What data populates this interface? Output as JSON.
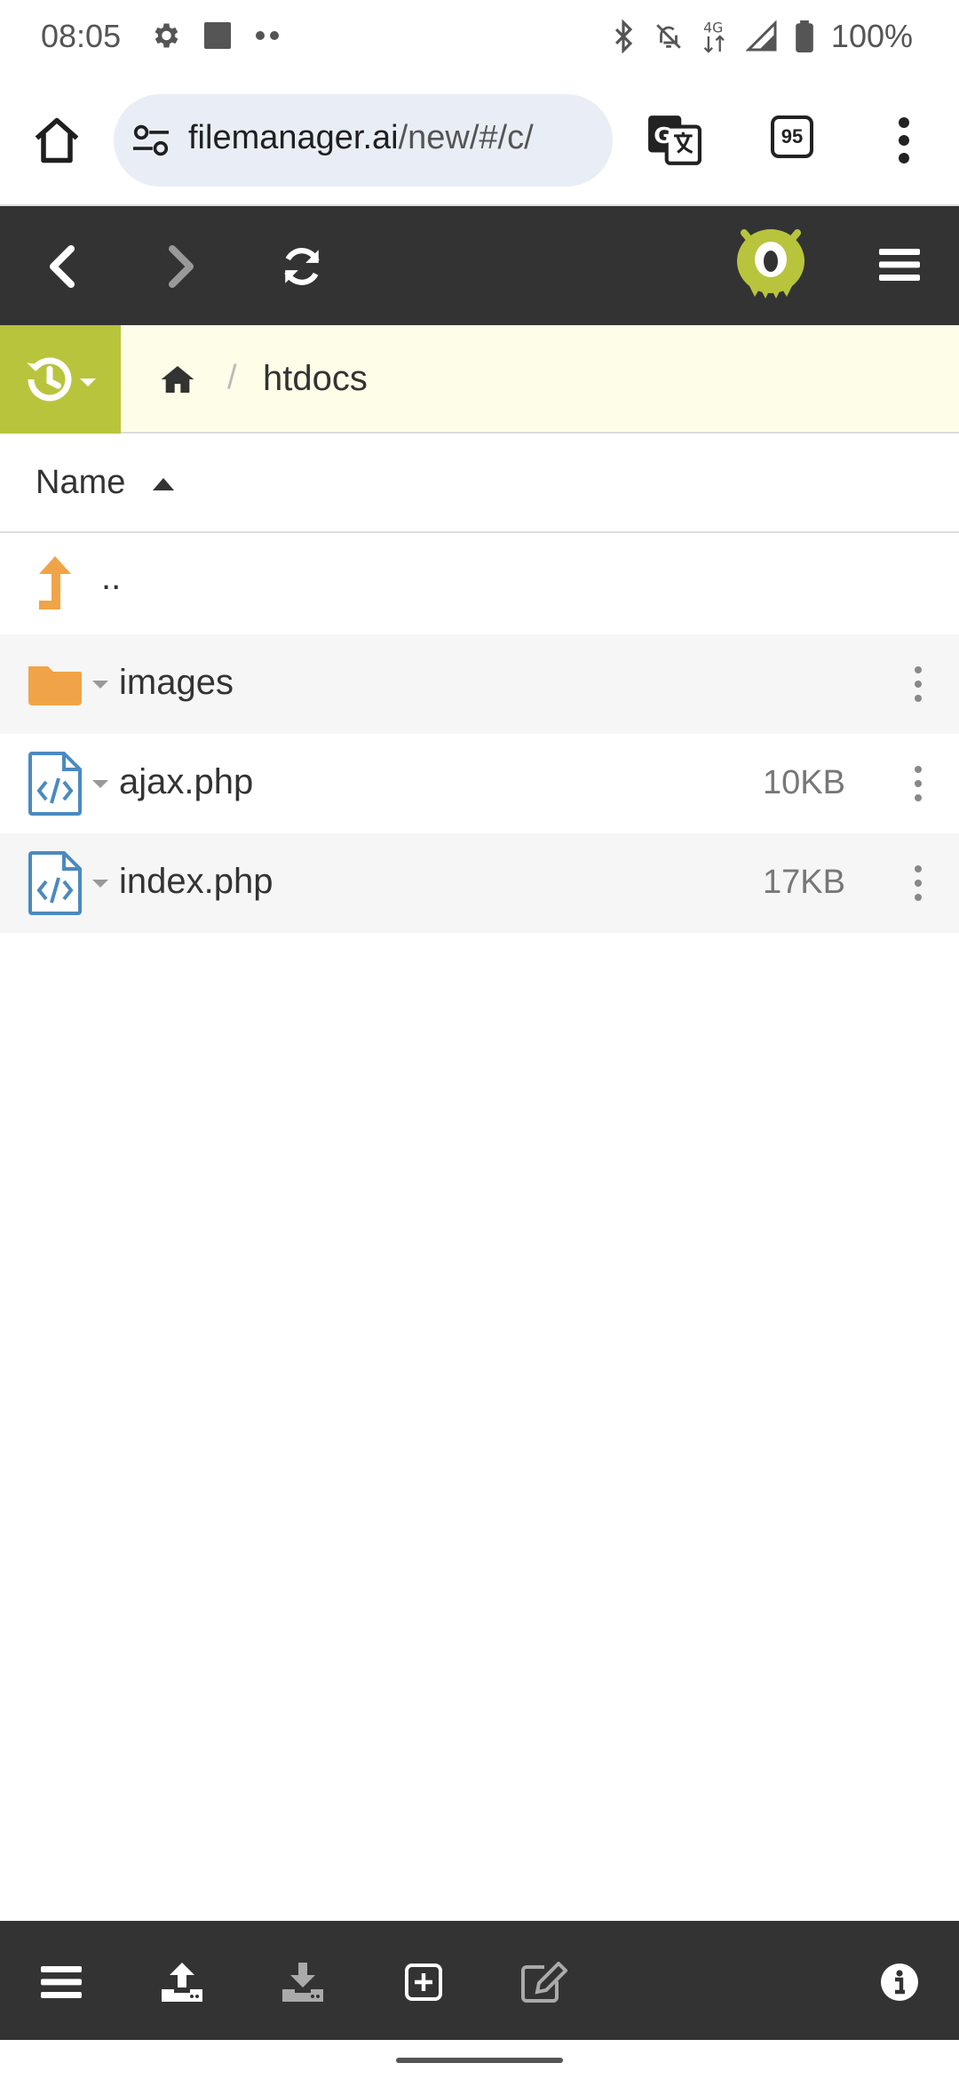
{
  "status_bar": {
    "time": "08:05",
    "battery": "100%",
    "network": "4G"
  },
  "browser": {
    "url_host": "filemanager.ai",
    "url_rest": "/new/#/c/",
    "tab_count": "95"
  },
  "breadcrumb": {
    "separator": "/",
    "current": "htdocs"
  },
  "list_header": {
    "name_label": "Name"
  },
  "files": [
    {
      "name": "..",
      "size": "",
      "type": "parent"
    },
    {
      "name": "images",
      "size": "",
      "type": "folder"
    },
    {
      "name": "ajax.php",
      "size": "10KB",
      "type": "code-file"
    },
    {
      "name": "index.php",
      "size": "17KB",
      "type": "code-file"
    }
  ],
  "colors": {
    "toolbar_bg": "#333333",
    "accent_green": "#b9c43d",
    "breadcrumb_bg": "#fefde8",
    "folder_orange": "#f0a447",
    "file_blue": "#4a8ac0"
  },
  "icons": {
    "toolbar": [
      "back-icon",
      "forward-icon",
      "refresh-icon",
      "monster-logo",
      "hamburger-icon"
    ],
    "bottom": [
      "menu-icon",
      "upload-icon",
      "download-icon",
      "new-file-icon",
      "edit-icon",
      "info-icon"
    ]
  }
}
